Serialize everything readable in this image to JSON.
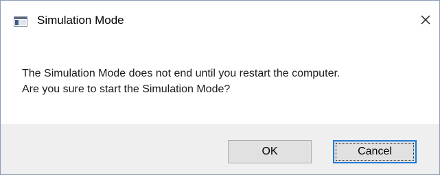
{
  "window": {
    "title": "Simulation Mode",
    "icon": "application-window-icon",
    "close_icon": "close-icon"
  },
  "message": {
    "line1": "The Simulation Mode does not end until you restart the computer.",
    "line2": "Are you sure to start the Simulation Mode?"
  },
  "buttons": {
    "ok_label": "OK",
    "cancel_label": "Cancel",
    "focused": "Cancel"
  },
  "colors": {
    "focus_border": "#1e7ad6",
    "footer_background": "#efefef",
    "button_background": "#e1e1e1"
  }
}
